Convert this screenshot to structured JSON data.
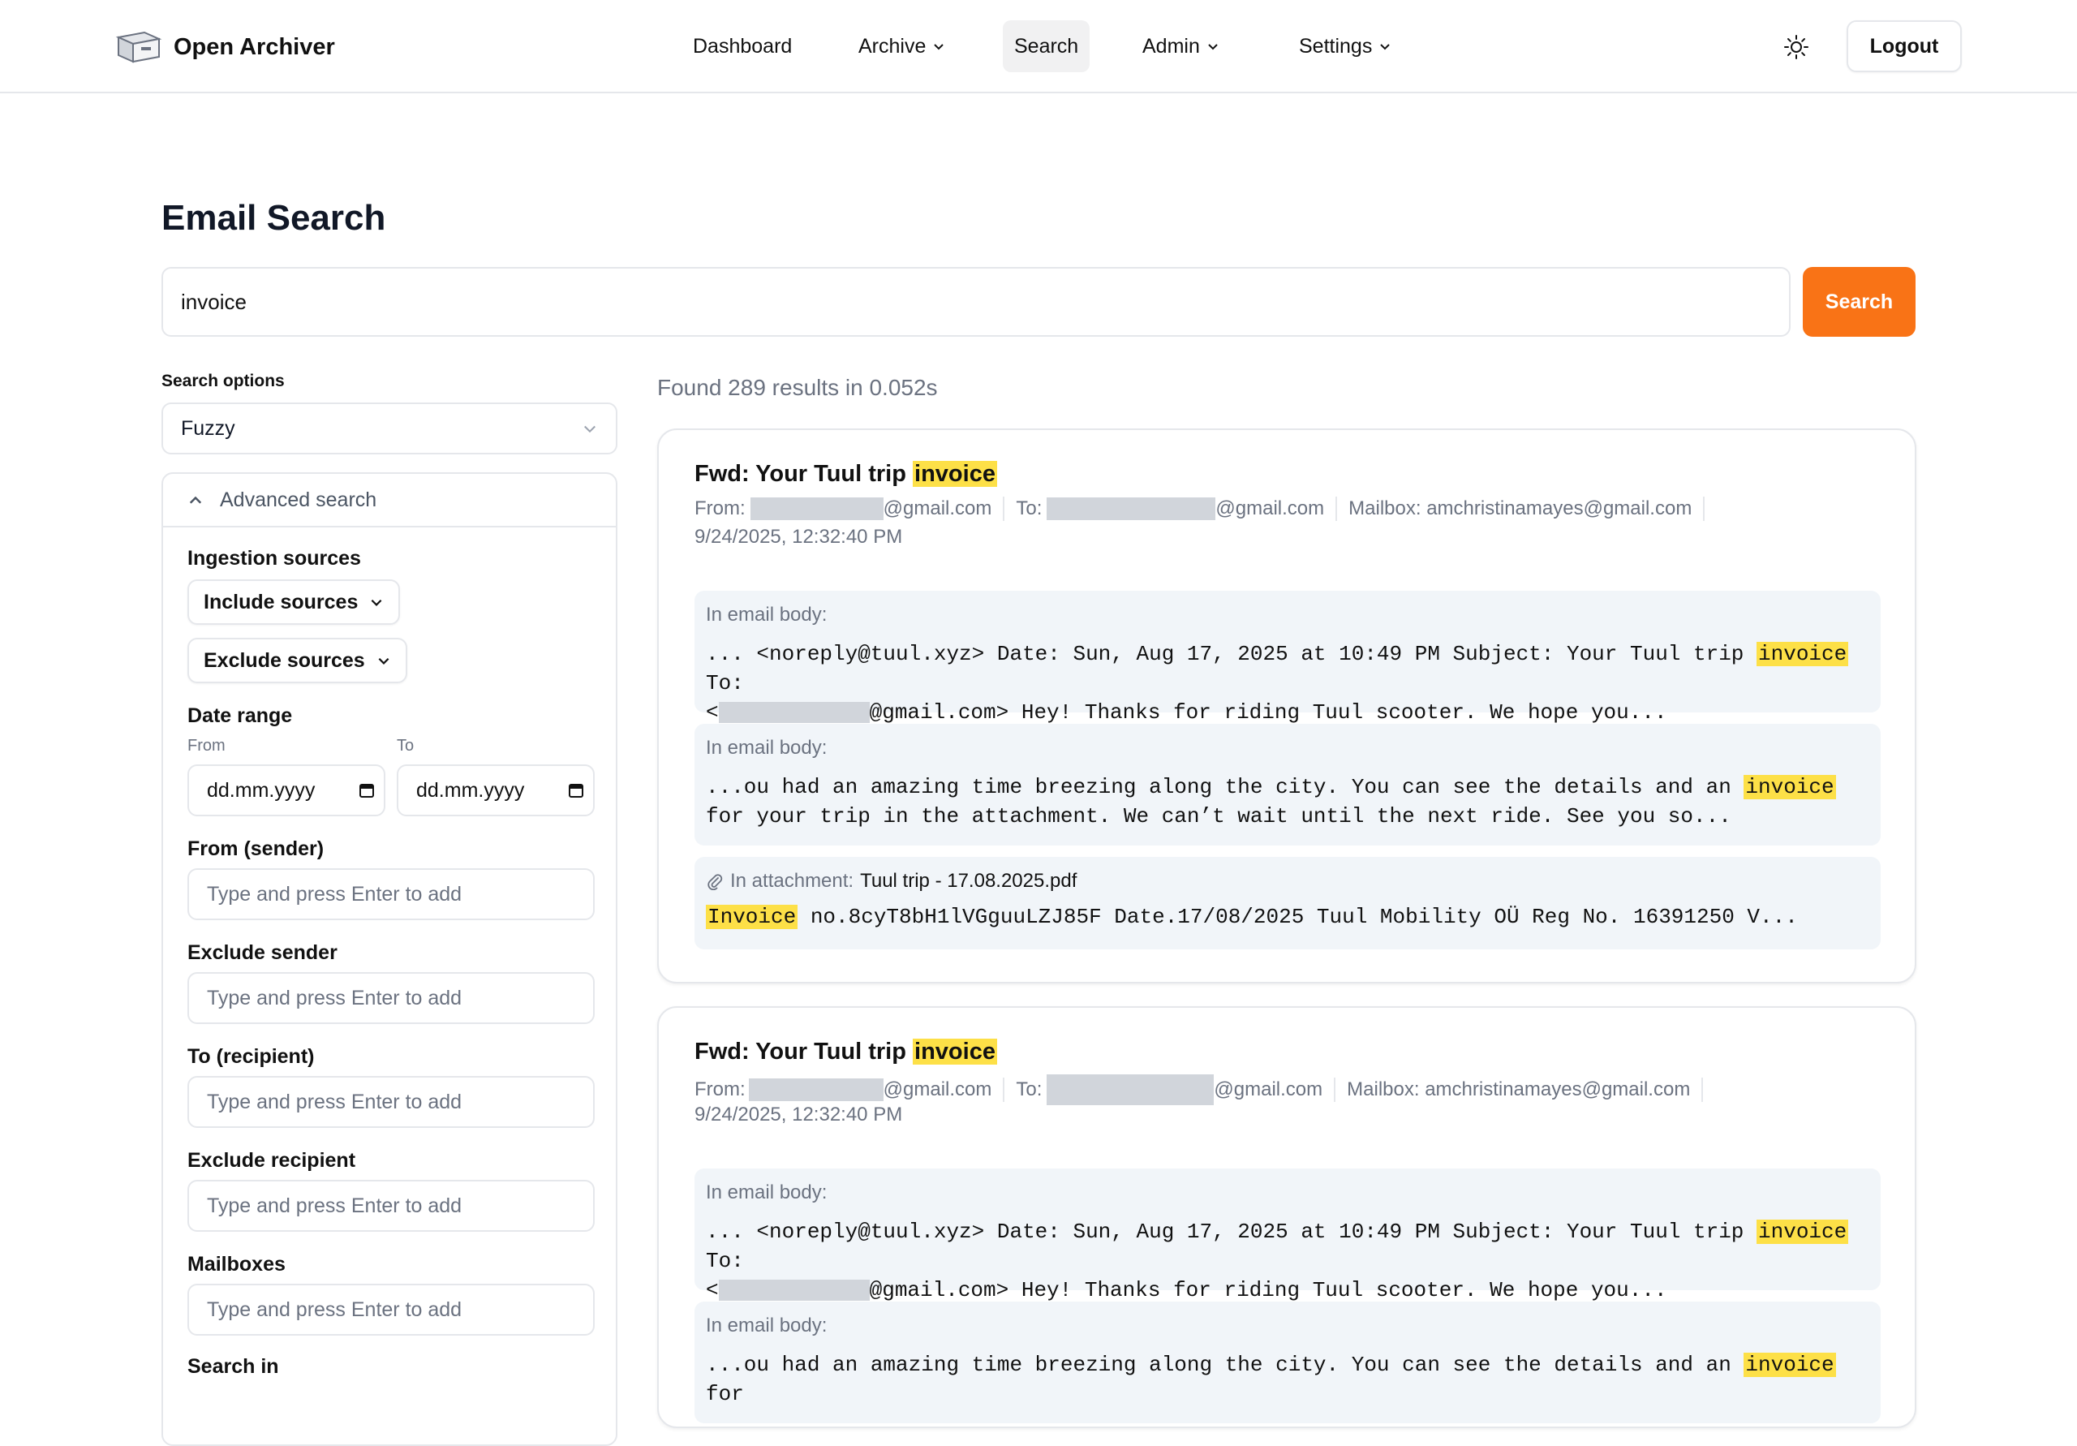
{
  "header": {
    "app_name": "Open Archiver",
    "nav": [
      {
        "label": "Dashboard"
      },
      {
        "label": "Archive"
      },
      {
        "label": "Search"
      },
      {
        "label": "Admin"
      },
      {
        "label": "Settings"
      }
    ],
    "logout_label": "Logout"
  },
  "page": {
    "title": "Email Search",
    "query": "invoice",
    "search_button": "Search"
  },
  "filters": {
    "options_label": "Search options",
    "mode": "Fuzzy",
    "advanced_label": "Advanced search",
    "ingestion_label": "Ingestion sources",
    "include_sources": "Include sources",
    "exclude_sources": "Exclude sources",
    "date_range_label": "Date range",
    "from_label": "From",
    "to_label": "To",
    "date_placeholder": "dd.mm.yyyy",
    "sender_label": "From (sender)",
    "exclude_sender_label": "Exclude sender",
    "recipient_label": "To (recipient)",
    "exclude_recipient_label": "Exclude recipient",
    "mailboxes_label": "Mailboxes",
    "search_in_label": "Search in",
    "tag_placeholder": "Type and press Enter to add"
  },
  "results": {
    "summary": "Found 289 results in 0.052s",
    "items": [
      {
        "subject_prefix": "Fwd: Your Tuul trip",
        "subject_hl": "invoice",
        "from_label": "From:",
        "from_domain": "@gmail.com",
        "to_label": "To:",
        "to_domain": "@gmail.com",
        "mailbox": "Mailbox: amchristinamayes@gmail.com",
        "date": "9/24/2025, 12:32:40 PM",
        "snippets": [
          {
            "label": "In email body:",
            "pre": "... <noreply@tuul.xyz> Date: Sun, Aug 17, 2025 at 10:49 PM Subject: Your Tuul trip ",
            "hl": "invoice",
            "post": " To:",
            "line2_pre": "<",
            "line2_post": "@gmail.com> Hey! Thanks for riding Tuul scooter. We hope you..."
          },
          {
            "label": "In email body:",
            "pre": "...ou had an amazing time breezing along the city. You can see the details and an ",
            "hl": "invoice",
            "post": " for your trip in the attachment. We can’t wait until the next ride. See you so..."
          },
          {
            "label": "In attachment:",
            "file": "Tuul trip - 17.08.2025.pdf",
            "hl": "Invoice",
            "post": " no.8cyT8bH1lVGguuLZJ85F Date.17/08/2025 Tuul Mobility OÜ Reg No. 16391250 V..."
          }
        ]
      },
      {
        "subject_prefix": "Fwd: Your Tuul trip",
        "subject_hl": "invoice",
        "from_label": "From:",
        "from_domain": "@gmail.com",
        "to_label": "To:",
        "to_domain": "@gmail.com",
        "mailbox": "Mailbox: amchristinamayes@gmail.com",
        "date": "9/24/2025, 12:32:40 PM",
        "snippets": [
          {
            "label": "In email body:",
            "pre": "... <noreply@tuul.xyz> Date: Sun, Aug 17, 2025 at 10:49 PM Subject: Your Tuul trip ",
            "hl": "invoice",
            "post": " To:",
            "line2_pre": "<",
            "line2_post": "@gmail.com> Hey! Thanks for riding Tuul scooter. We hope you..."
          },
          {
            "label": "In email body:",
            "pre": "...ou had an amazing time breezing along the city. You can see the details and an ",
            "hl": "invoice",
            "post": " for"
          }
        ]
      }
    ]
  }
}
